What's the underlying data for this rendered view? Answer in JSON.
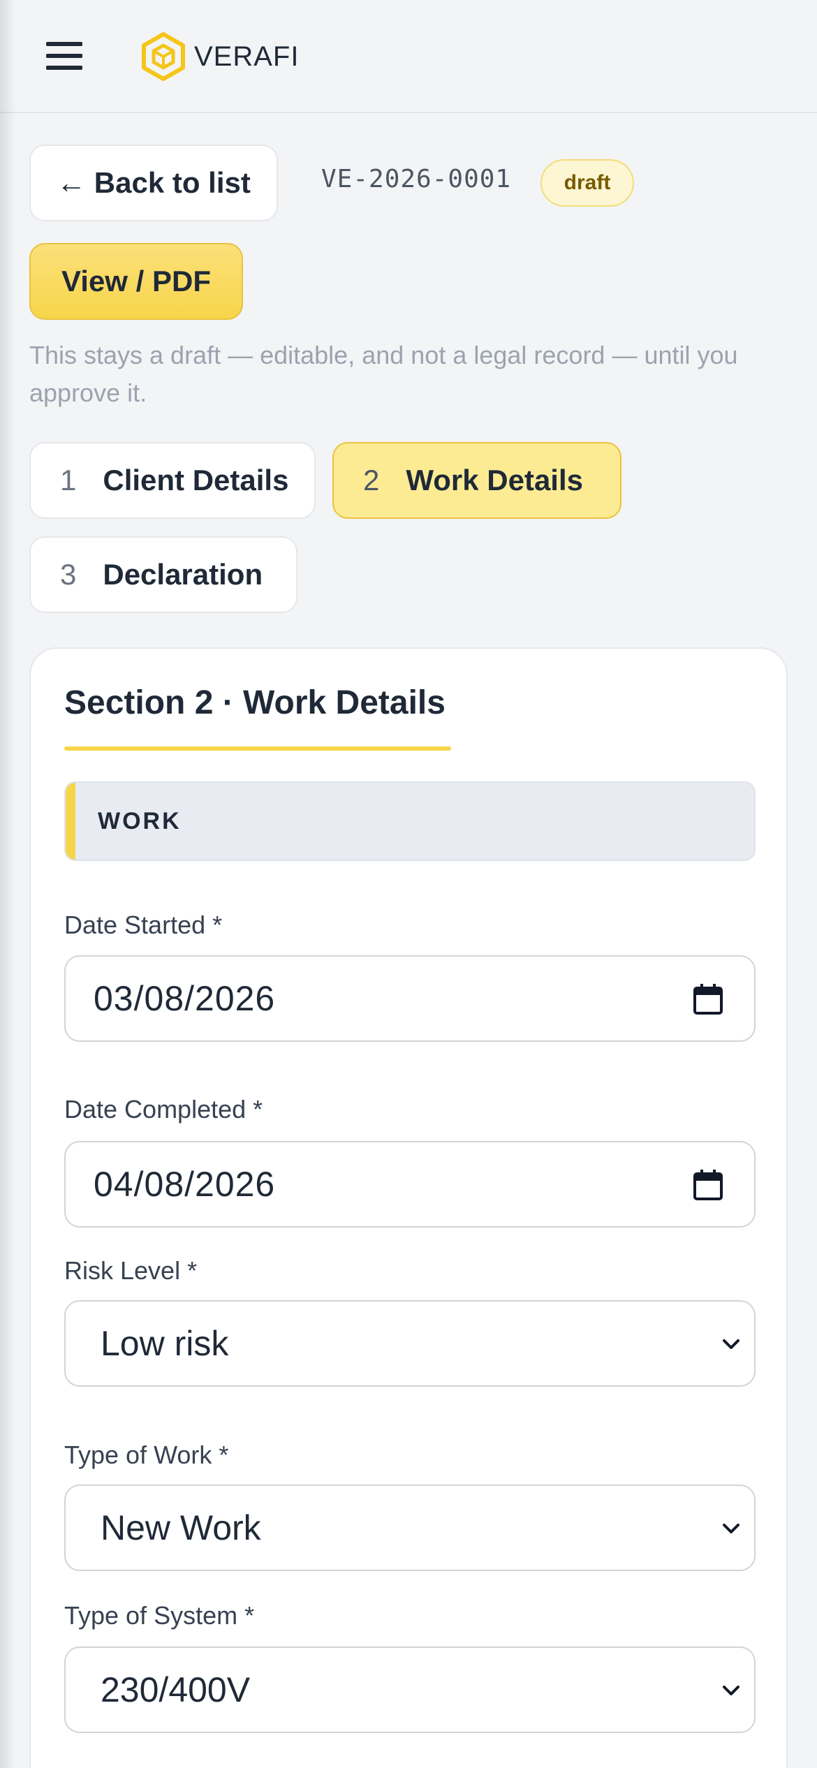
{
  "header": {
    "brand": "VERAFI",
    "menu_icon": "hamburger-menu-icon",
    "logo_icon": "hexagon-cube-logo",
    "accent_color": "#f7d54a"
  },
  "toolbar": {
    "back_label": "← Back to list",
    "doc_id": "VE-2026-0001",
    "status": "draft",
    "pdf_label": "View / PDF",
    "note": "This stays a draft — editable, and not a legal record — until you approve it."
  },
  "steps": [
    {
      "num": "1",
      "label": "Client Details",
      "active": false
    },
    {
      "num": "2",
      "label": "Work Details",
      "active": true
    },
    {
      "num": "3",
      "label": "Declaration",
      "active": false
    }
  ],
  "section": {
    "title": "Section 2 · Work Details",
    "group_label": "WORK",
    "fields": [
      {
        "label": "Date Started *",
        "value": "03/08/2026",
        "kind": "date",
        "icon": "calendar-icon"
      },
      {
        "label": "Date Completed *",
        "value": "04/08/2026",
        "kind": "date",
        "icon": "calendar-icon"
      },
      {
        "label": "Risk Level *",
        "value": "Low risk",
        "kind": "select",
        "icon": "chevron-down-icon"
      },
      {
        "label": "Type of Work *",
        "value": "New Work",
        "kind": "select",
        "icon": "chevron-down-icon"
      },
      {
        "label": "Type of System *",
        "value": "230/400V",
        "kind": "select",
        "icon": "chevron-down-icon"
      }
    ]
  }
}
